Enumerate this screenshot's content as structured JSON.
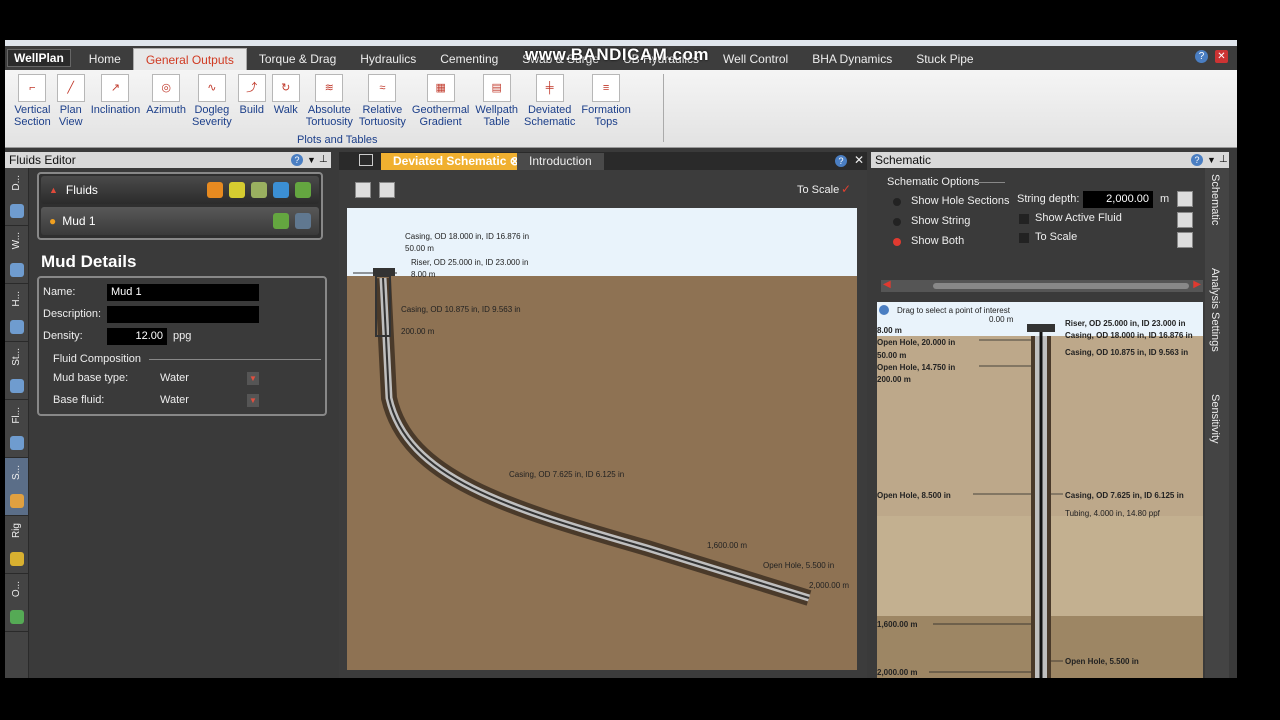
{
  "watermark": "www.BANDICAM.com",
  "menu": {
    "app_button": "WellPlan",
    "tabs": [
      "Home",
      "General Outputs",
      "Torque & Drag",
      "Hydraulics",
      "Cementing",
      "Swab & Surge",
      "UB Hydraulics",
      "Well Control",
      "BHA Dynamics",
      "Stuck Pipe"
    ],
    "active_tab": "General Outputs"
  },
  "ribbon": {
    "items": [
      "Vertical\nSection",
      "Plan\nView",
      "Inclination",
      "Azimuth",
      "Dogleg\nSeverity",
      "Build",
      "Walk",
      "Absolute\nTortuosity",
      "Relative\nTortuosity",
      "Geothermal\nGradient",
      "Wellpath\nTable",
      "Deviated\nSchematic",
      "Formation\nTops"
    ],
    "group_label": "Plots and Tables"
  },
  "fluids_editor": {
    "title": "Fluids Editor",
    "fluids_header": "Fluids",
    "mud_item": "Mud 1",
    "vtabs": [
      "D...",
      "W...",
      "H...",
      "St...",
      "Fl...",
      "S...",
      "Rig",
      "O..."
    ],
    "mud_details": {
      "title": "Mud Details",
      "name_label": "Name:",
      "name_value": "Mud 1",
      "description_label": "Description:",
      "description_value": "",
      "density_label": "Density:",
      "density_value": "12.00",
      "density_unit": "ppg",
      "composition_label": "Fluid Composition",
      "base_type_label": "Mud base type:",
      "base_type_value": "Water",
      "base_fluid_label": "Base fluid:",
      "base_fluid_value": "Water"
    }
  },
  "center": {
    "tabs": [
      "Deviated Schematic",
      "Introduction"
    ],
    "to_scale_label": "To Scale",
    "labels": {
      "c18": "Casing, OD 18.000 in, ID 16.876 in",
      "d50": "50.00 m",
      "riser": "Riser, OD 25.000 in, ID 23.000 in",
      "d8": "8.00 m",
      "c10": "Casing, OD 10.875 in, ID 9.563 in",
      "d200": "200.00 m",
      "c7": "Casing, OD 7.625 in, ID 6.125 in",
      "d1600": "1,600.00 m",
      "oh": "Open Hole, 5.500 in",
      "d2000": "2,000.00 m"
    }
  },
  "schematic": {
    "title": "Schematic",
    "options_label": "Schematic Options",
    "radios": [
      "Show Hole Sections",
      "Show String",
      "Show Both"
    ],
    "selected_radio": "Show Both",
    "string_depth_label": "String depth:",
    "string_depth_value": "2,000.00",
    "string_depth_unit": "m",
    "checks": [
      "Show Active Fluid",
      "To Scale"
    ],
    "hint": "Drag to select a point of interest",
    "side_tabs": [
      "Schematic",
      "Analysis Settings",
      "Sensitivity"
    ],
    "labels": {
      "d0": "0.00 m",
      "riser": "Riser, OD 25.000 in, ID 23.000 in",
      "c18": "Casing, OD 18.000 in, ID 16.876 in",
      "c10": "Casing, OD 10.875 in, ID 9.563 in",
      "d8": "8.00 m",
      "oh20": "Open Hole, 20.000 in",
      "d50": "50.00 m",
      "oh14": "Open Hole, 14.750 in",
      "d200": "200.00 m",
      "oh85": "Open Hole, 8.500 in",
      "c7": "Casing, OD 7.625 in, ID 6.125 in",
      "tubing": "Tubing, 4.000 in, 14.80 ppf",
      "d1600": "1,600.00 m",
      "oh55": "Open Hole, 5.500 in",
      "d2000": "2,000.00 m"
    }
  },
  "colors": {
    "accent": "#f0b030",
    "earth": "#8e7253",
    "sky": "#e9f3fb",
    "panel": "#3a3a3a"
  }
}
